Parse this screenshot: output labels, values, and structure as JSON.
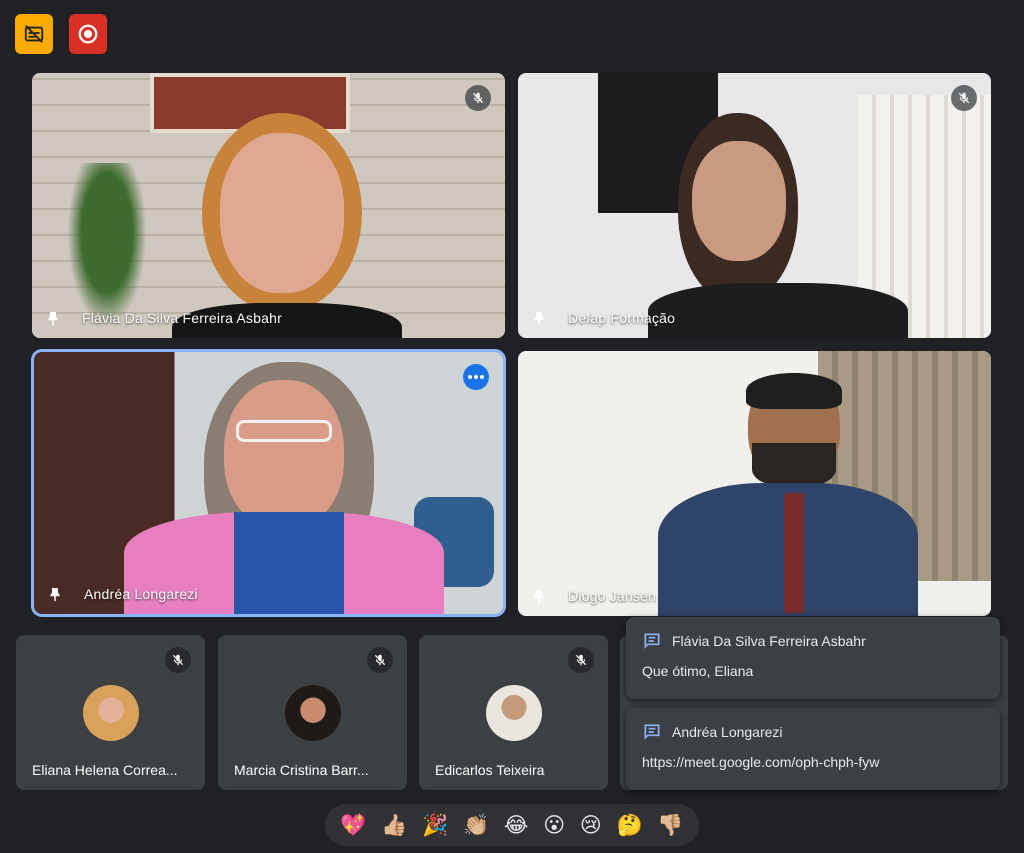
{
  "badges": {
    "captions_icon": "captions-off-icon",
    "record_icon": "recording-icon"
  },
  "main_tiles": [
    {
      "name": "Flávia Da Silva Ferreira Asbahr",
      "muted": true
    },
    {
      "name": "Defap Formação",
      "muted": true
    },
    {
      "name": "Andréa Longarezi",
      "active": true
    },
    {
      "name": "Diogo Jansen"
    }
  ],
  "small_tiles": [
    {
      "name": "Eliana Helena Correa...",
      "muted": true
    },
    {
      "name": "Marcia Cristina Barr...",
      "muted": true
    },
    {
      "name": "Edicarlos Teixeira",
      "muted": true
    }
  ],
  "chat": [
    {
      "sender": "Flávia Da Silva Ferreira Asbahr",
      "message": "Que ótimo, Eliana"
    },
    {
      "sender": "Andréa Longarezi",
      "message": "https://meet.google.com/oph-chph-fyw"
    }
  ],
  "reactions": [
    "💖",
    "👍🏼",
    "🎉",
    "👏🏼",
    "😂",
    "😮",
    "😢",
    "🤔",
    "👎🏼"
  ],
  "colors": {
    "background": "#202124",
    "tile": "#3c4043",
    "accent": "#1a73e8",
    "active_border": "#8ab4f8",
    "captions": "#f9ab00",
    "record": "#d93025"
  }
}
